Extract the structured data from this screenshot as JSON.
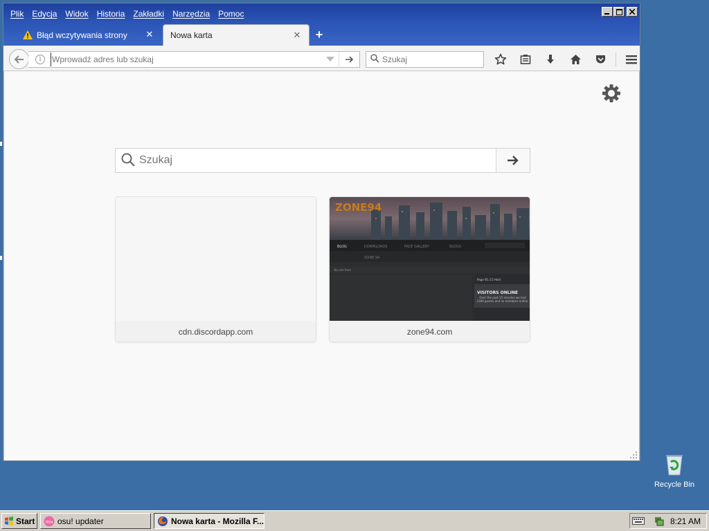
{
  "menu": [
    "Plik",
    "Edycja",
    "Widok",
    "Historia",
    "Zakładki",
    "Narzędzia",
    "Pomoc"
  ],
  "window_controls": {
    "minimize": "_",
    "maximize": "□",
    "close": "✕"
  },
  "tabs": [
    {
      "label": "Błąd wczytywania strony",
      "icon": "warning-icon",
      "active": false
    },
    {
      "label": "Nowa karta",
      "active": true
    }
  ],
  "toolbar": {
    "url_placeholder": "Wprowadź adres lub szukaj",
    "search_placeholder": "Szukaj",
    "icons": [
      "bookmark-star-icon",
      "reading-list-icon",
      "download-icon",
      "home-icon",
      "pocket-icon",
      "hamburger-menu-icon"
    ]
  },
  "newtab": {
    "search_placeholder": "Szukaj",
    "tiles": [
      {
        "title": "cdn.discordapp.com"
      },
      {
        "title": "zone94.com"
      }
    ],
    "zone94_thumb": {
      "logo": "ZONE94",
      "nav": [
        "BLOG",
        "DOWNLOADS",
        "FACE GALLERY",
        "BLOGS"
      ],
      "subnav": "ZONE 94",
      "breadcrumb": "You are here",
      "widget_head": "Page 95.3.5 Host",
      "widget_title": "VISITORS ONLINE",
      "widget_text": "Over the past 15 minutes we had 1300 guests and no members online."
    }
  },
  "desktop": {
    "recycle_bin": "Recycle Bin"
  },
  "taskbar": {
    "start": "Start",
    "buttons": [
      {
        "label": "osu! updater",
        "icon": "osu-icon"
      },
      {
        "label": "Nowa karta - Mozilla F...",
        "icon": "firefox-icon",
        "active": true
      }
    ],
    "clock": "8:21 AM"
  },
  "colors": {
    "desktop": "#3a6ea5",
    "titlebar": "#2b55b6",
    "taskbar": "#d4d0c8"
  }
}
